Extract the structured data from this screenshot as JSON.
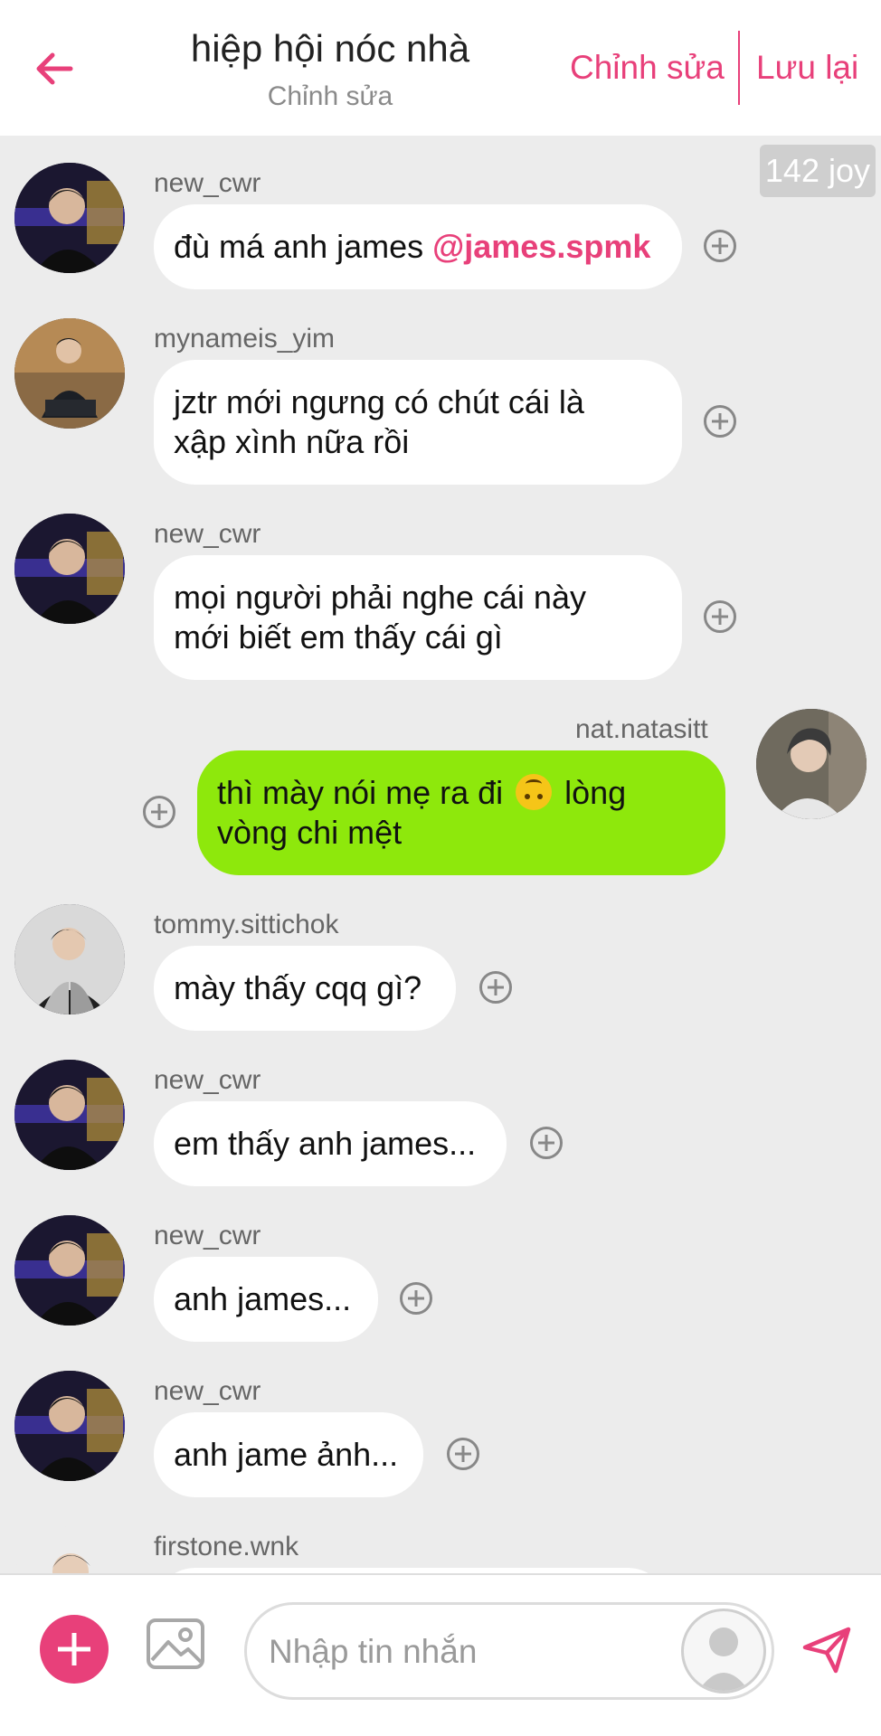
{
  "header": {
    "title": "hiệp hội nóc nhà",
    "subtitle": "Chỉnh sửa",
    "edit_label": "Chỉnh sửa",
    "save_label": "Lưu lại",
    "accent_color": "#e8407a"
  },
  "chat": {
    "joy_badge": "142 joy",
    "messages": [
      {
        "user": "new_cwr",
        "lines": [
          "đù má anh james "
        ],
        "mention": "@james.spmk",
        "side": "left"
      },
      {
        "user": "mynameis_yim",
        "lines": [
          "jztr mới ngưng có chút cái là",
          "xập xình nữa rồi"
        ],
        "side": "left"
      },
      {
        "user": "new_cwr",
        "lines": [
          "mọi người phải nghe cái này",
          "mới biết em thấy cái gì"
        ],
        "side": "left"
      },
      {
        "user": "nat.natasitt",
        "line1_before_emoji": "thì mày nói mẹ ra đi ",
        "line1_after_emoji": " lòng",
        "line2": "vòng chi mệt",
        "emoji": "upside-down-face-icon",
        "side": "right"
      },
      {
        "user": "tommy.sittichok",
        "lines": [
          "mày thấy cqq gì?"
        ],
        "side": "left"
      },
      {
        "user": "new_cwr",
        "lines": [
          "em thấy anh james..."
        ],
        "side": "left"
      },
      {
        "user": "new_cwr",
        "lines": [
          "anh james..."
        ],
        "side": "left"
      },
      {
        "user": "new_cwr",
        "lines": [
          "anh jame ảnh..."
        ],
        "side": "left"
      },
      {
        "user": "firstone.wnk",
        "lines": [],
        "side": "left"
      }
    ]
  },
  "composer": {
    "placeholder": "Nhập tin nhắn",
    "add_icon": "plus-icon",
    "image_icon": "image-icon",
    "send_icon": "send-icon"
  },
  "colors": {
    "my_bubble": "#8ee80c",
    "other_bubble": "#ffffff",
    "chat_background": "#ececec"
  }
}
